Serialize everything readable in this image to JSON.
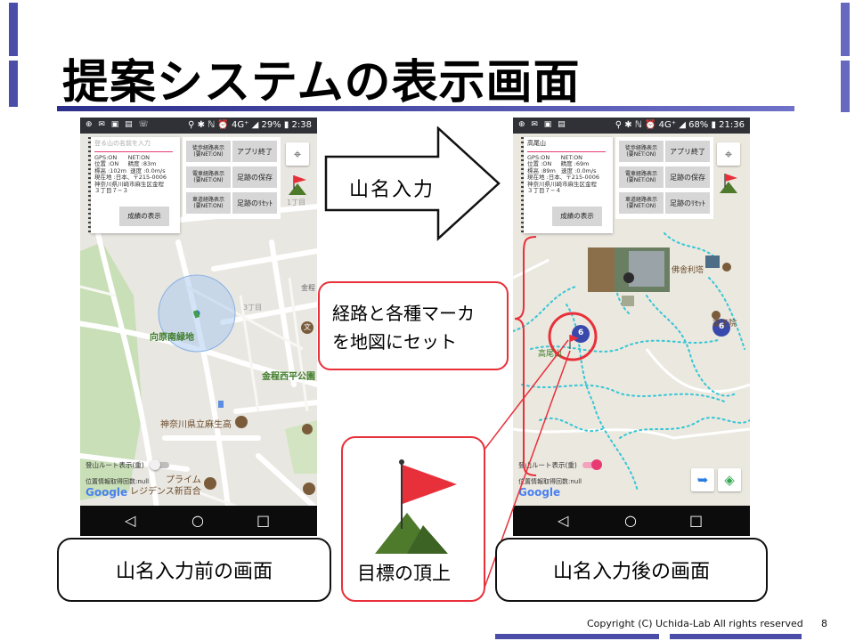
{
  "slide": {
    "title": "提案システムの表示画面",
    "footer": "Copyright (C) Uchida-Lab  All rights reserved",
    "page_number": "8"
  },
  "arrow_label": "山名入力",
  "callouts": {
    "before_caption": "山名入力前の画面",
    "after_caption": "山名入力後の画面",
    "summit_caption": "目標の頂上",
    "route_note_line1": "経路と各種マーカ",
    "route_note_line2": "を地図にセット"
  },
  "phone_left": {
    "status_icons": "⊕ ✉ ▣ ▤ ☏",
    "status_right": "⚲ ✱ ℕ ⏰ 4G⁺ ◢ 29% ▮ 2:38",
    "search_placeholder": "登る山の名前を入力",
    "info": "GPS:ON      NET:ON\n位置 :ON     精度 :83m\n標高 :102m  速度 :0.0m/s\n現在地 :日本、〒215-0006\n神奈川県川崎市麻生区金程\n３丁目７−３",
    "show_results": "成績の表示",
    "btn_walk_route": "徒歩経路表示\n(要NET:ON)",
    "btn_quit": "アプリ終了",
    "btn_train_route": "電車経路表示\n(要NET:ON)",
    "btn_save_track": "足跡の保存",
    "btn_car_route": "車道経路表示\n(要NET:ON)",
    "btn_reset_track": "足跡のﾘｾｯﾄ",
    "toggle_label": "登山ルート表示(重)",
    "log_count": "位置情報取得回数:null",
    "google": "Google",
    "map_labels": [
      "向原南緑地",
      "金程西平公園",
      "神奈川県立麻生高",
      "プライム",
      "レジデンス新百合",
      "3丁目",
      "1丁目",
      "金程",
      "文"
    ],
    "nav": [
      "◁",
      "○",
      "□"
    ]
  },
  "phone_right": {
    "status_icons": "⊕ ✉ ▣ ▤",
    "status_right": "⚲ ✱ ℕ ⏰ 4G⁺ ◢ 68% ▮ 21:36",
    "search_value": "高尾山",
    "info": "GPS:ON      NET:ON\n位置 :ON     精度 :69m\n標高 :89m   速度 :0.0m/s\n現在地 :日本、〒215-0006\n神奈川県川崎市麻生区金程\n３丁目７−４",
    "show_results": "成績の表示",
    "btn_walk_route": "徒歩経路表示\n(要NET:ON)",
    "btn_quit": "アプリ終了",
    "btn_train_route": "電車経路表示\n(要NET:ON)",
    "btn_save_track": "足跡の保存",
    "btn_car_route": "車道経路表示\n(要NET:ON)",
    "btn_reset_track": "足跡のﾘｾｯﾄ",
    "toggle_label": "登山ルート表示(重)",
    "log_count": "位置情報取得回数:null",
    "google": "Google",
    "map_labels": [
      "佛舎利塔",
      "薬王院",
      "高尾山"
    ],
    "marker_counts": [
      "6",
      "6"
    ],
    "nav": [
      "◁",
      "○",
      "□"
    ]
  },
  "colors": {
    "accent_blue": "#4b4ea8",
    "highlight_red": "#e8303a",
    "flag_red": "#e8303a",
    "mountain_green": "#4e7a2c",
    "route_cyan": "#35c6d6",
    "toggle_pink": "#e83b74"
  }
}
